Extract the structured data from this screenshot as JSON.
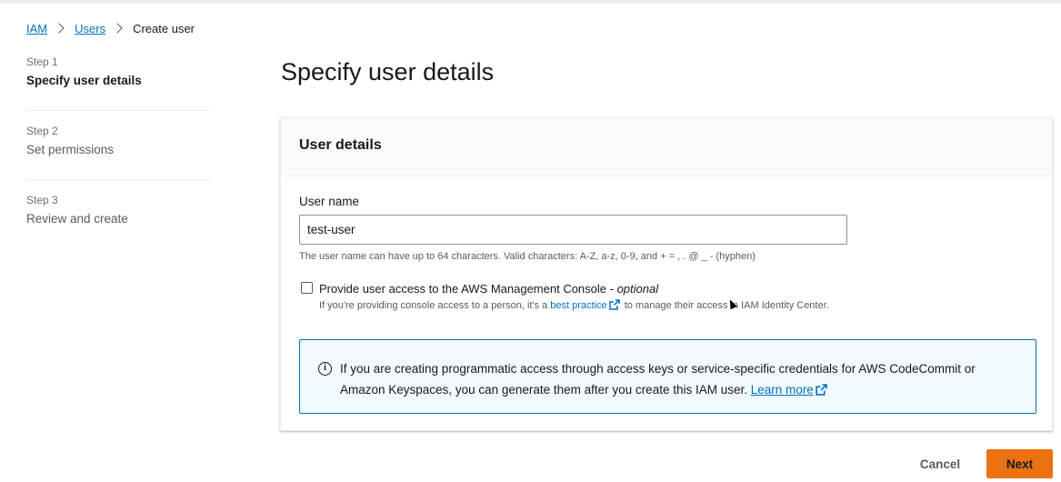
{
  "breadcrumb": {
    "items": [
      "IAM",
      "Users"
    ],
    "current": "Create user"
  },
  "steps": [
    {
      "num": "Step 1",
      "title": "Specify user details",
      "active": true
    },
    {
      "num": "Step 2",
      "title": "Set permissions",
      "active": false
    },
    {
      "num": "Step 3",
      "title": "Review and create",
      "active": false
    }
  ],
  "page_title": "Specify user details",
  "user_details": {
    "header": "User details",
    "label": "User name",
    "value": "test-user",
    "constraint": "The user name can have up to 64 characters. Valid characters: A-Z, a-z, 0-9, and + = , . @ _ - (hyphen)"
  },
  "console_access": {
    "checked": false,
    "label": "Provide user access to the AWS Management Console - ",
    "optional": "optional",
    "desc_before": "If you're providing console access to a person, it's a ",
    "desc_link": "best practice",
    "desc_after": " to manage their access in IAM Identity Center."
  },
  "info": {
    "icon": "info-icon",
    "text": "If you are creating programmatic access through access keys or service-specific credentials for AWS CodeCommit or Amazon Keyspaces, you can generate them after you create this IAM user. ",
    "link": "Learn more"
  },
  "buttons": {
    "cancel": "Cancel",
    "next": "Next"
  },
  "colors": {
    "accent": "#ec7211",
    "link": "#0073bb",
    "info_bg": "#f1faff"
  }
}
